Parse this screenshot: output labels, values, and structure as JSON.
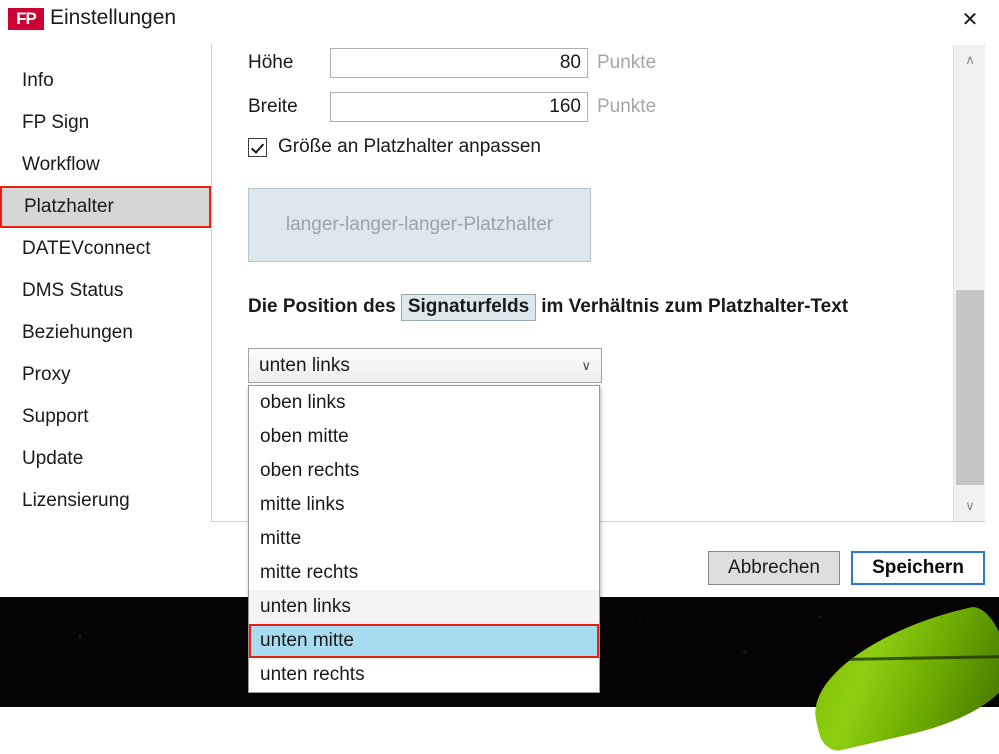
{
  "window": {
    "title": "Einstellungen",
    "logo_text": "FP",
    "logo_color": "#cc0033",
    "close_icon": "close-icon",
    "close_glyph": "✕"
  },
  "sidebar": {
    "items": [
      {
        "label": "Info",
        "selected": false
      },
      {
        "label": "FP Sign",
        "selected": false
      },
      {
        "label": "Workflow",
        "selected": false
      },
      {
        "label": "Platzhalter",
        "selected": true
      },
      {
        "label": "DATEVconnect",
        "selected": false
      },
      {
        "label": "DMS Status",
        "selected": false
      },
      {
        "label": "Beziehungen",
        "selected": false
      },
      {
        "label": "Proxy",
        "selected": false
      },
      {
        "label": "Support",
        "selected": false
      },
      {
        "label": "Update",
        "selected": false
      },
      {
        "label": "Lizensierung",
        "selected": false
      }
    ],
    "selection_highlight_color": "#e8200f",
    "selection_background": "#d6d6d6"
  },
  "form": {
    "height_field": {
      "label": "Höhe",
      "value": "80",
      "unit": "Punkte"
    },
    "width_field": {
      "label": "Breite",
      "value": "160",
      "unit": "Punkte"
    },
    "resize_checkbox": {
      "label": "Größe an Platzhalter anpassen",
      "checked": true
    },
    "placeholder_preview": {
      "text": "langer-langer-langer-Platzhalter",
      "background": "#dde8ed",
      "text_color": "#9aa3a8"
    },
    "position_caption": {
      "prefix": "Die Position des",
      "chip": "Signaturfelds",
      "suffix": "im Verhältnis zum Platzhalter-Text"
    },
    "position_select": {
      "value": "unten links",
      "chevron_icon": "chevron-down-icon",
      "chevron_glyph": "∨",
      "open": true,
      "options": [
        {
          "label": "oben links",
          "state": "normal"
        },
        {
          "label": "oben mitte",
          "state": "normal"
        },
        {
          "label": "oben rechts",
          "state": "normal"
        },
        {
          "label": "mitte links",
          "state": "normal"
        },
        {
          "label": "mitte",
          "state": "normal"
        },
        {
          "label": "mitte rechts",
          "state": "normal"
        },
        {
          "label": "unten links",
          "state": "current"
        },
        {
          "label": "unten mitte",
          "state": "highlighted"
        },
        {
          "label": "unten rechts",
          "state": "normal"
        }
      ],
      "highlight_color": "#a8dcf0",
      "annotation_color": "#e8200f"
    }
  },
  "scrollbar": {
    "up_icon": "chevron-up-icon",
    "up_glyph": "∧",
    "down_icon": "chevron-down-icon",
    "down_glyph": "∨"
  },
  "footer": {
    "cancel_label": "Abbrechen",
    "save_label": "Speichern",
    "save_focus_color": "#2a7ad1"
  }
}
